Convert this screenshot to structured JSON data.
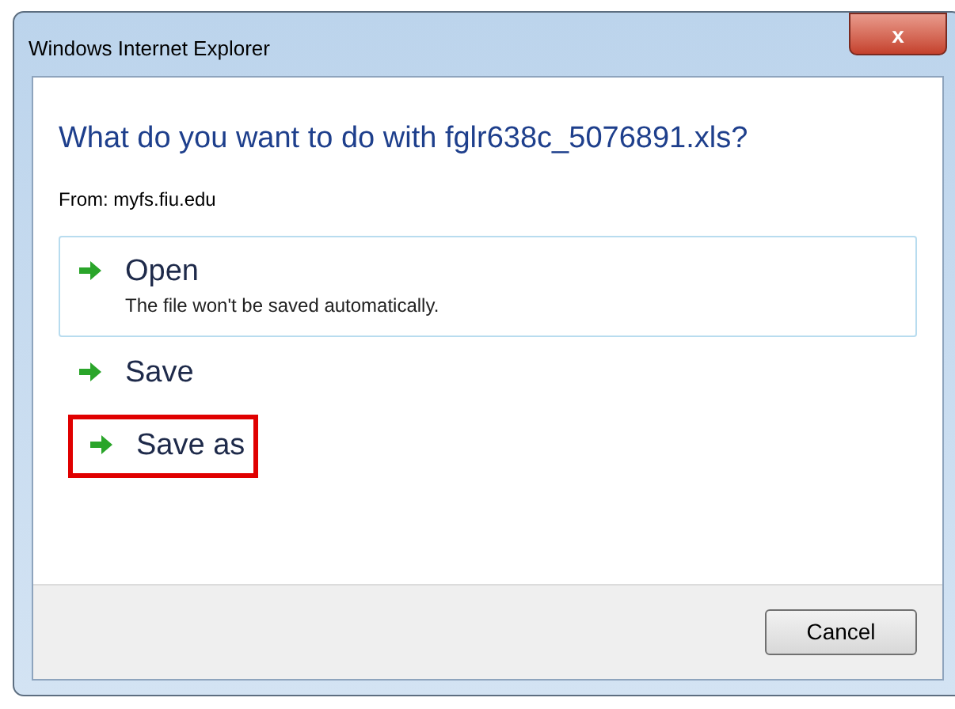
{
  "window": {
    "title": "Windows Internet Explorer",
    "close": "x"
  },
  "question": "What do you want to do with fglr638c_5076891.xls?",
  "source": "From: myfs.fiu.edu",
  "options": [
    {
      "label": "Open",
      "description": "The file won't be saved automatically.",
      "selected": true,
      "highlighted": false
    },
    {
      "label": "Save",
      "selected": false,
      "highlighted": false
    },
    {
      "label": "Save as",
      "selected": false,
      "highlighted": true
    }
  ],
  "buttons": [
    "Cancel"
  ]
}
